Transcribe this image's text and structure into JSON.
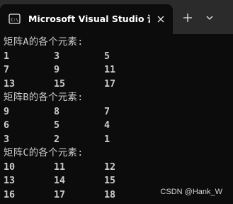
{
  "window": {
    "tab_title": "Microsoft Visual Studio 调试控",
    "tab_icon": "terminal-icon",
    "close_icon": "close-icon",
    "new_tab_icon": "plus-icon",
    "dropdown_icon": "chevron-down-icon"
  },
  "console": {
    "matrices": [
      {
        "heading": "矩阵A的各个元素:",
        "rows": [
          [
            "1",
            "3",
            "5"
          ],
          [
            "7",
            "9",
            "11"
          ],
          [
            "13",
            "15",
            "17"
          ]
        ]
      },
      {
        "heading": "矩阵B的各个元素:",
        "rows": [
          [
            "9",
            "8",
            "7"
          ],
          [
            "6",
            "5",
            "4"
          ],
          [
            "3",
            "2",
            "1"
          ]
        ]
      },
      {
        "heading": "矩阵C的各个元素:",
        "rows": [
          [
            "10",
            "11",
            "12"
          ],
          [
            "13",
            "14",
            "15"
          ],
          [
            "16",
            "17",
            "18"
          ]
        ]
      }
    ]
  },
  "watermark": "CSDN @Hank_W",
  "colors": {
    "titlebar": "#2b2b2b",
    "console_bg": "#0c0c0c",
    "text": "#cccccc"
  }
}
